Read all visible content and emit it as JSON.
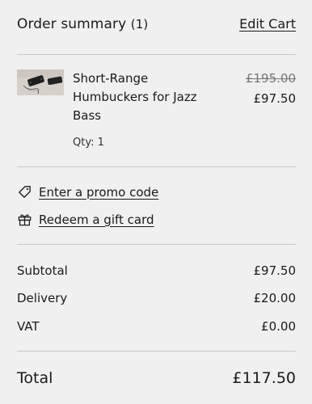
{
  "header": {
    "title": "Order summary",
    "count": "(1)",
    "edit_cart_label": "Edit Cart"
  },
  "item": {
    "name": "Short-Range Humbuckers for Jazz Bass",
    "qty_label": "Qty: 1",
    "original_price": "£195.00",
    "sale_price": "£97.50",
    "thumbnail_icon": "product-image"
  },
  "links": {
    "promo": {
      "label": "Enter a promo code",
      "icon": "tag-icon"
    },
    "gift": {
      "label": "Redeem a gift card",
      "icon": "gift-icon"
    }
  },
  "summary": {
    "subtotal": {
      "label": "Subtotal",
      "value": "£97.50"
    },
    "delivery": {
      "label": "Delivery",
      "value": "£20.00"
    },
    "vat": {
      "label": "VAT",
      "value": "£0.00"
    }
  },
  "total": {
    "label": "Total",
    "value": "£117.50"
  },
  "colors": {
    "background": "#f0f0f0",
    "text": "#1a1a1a",
    "muted": "#777777",
    "divider": "#c9c9c9"
  }
}
